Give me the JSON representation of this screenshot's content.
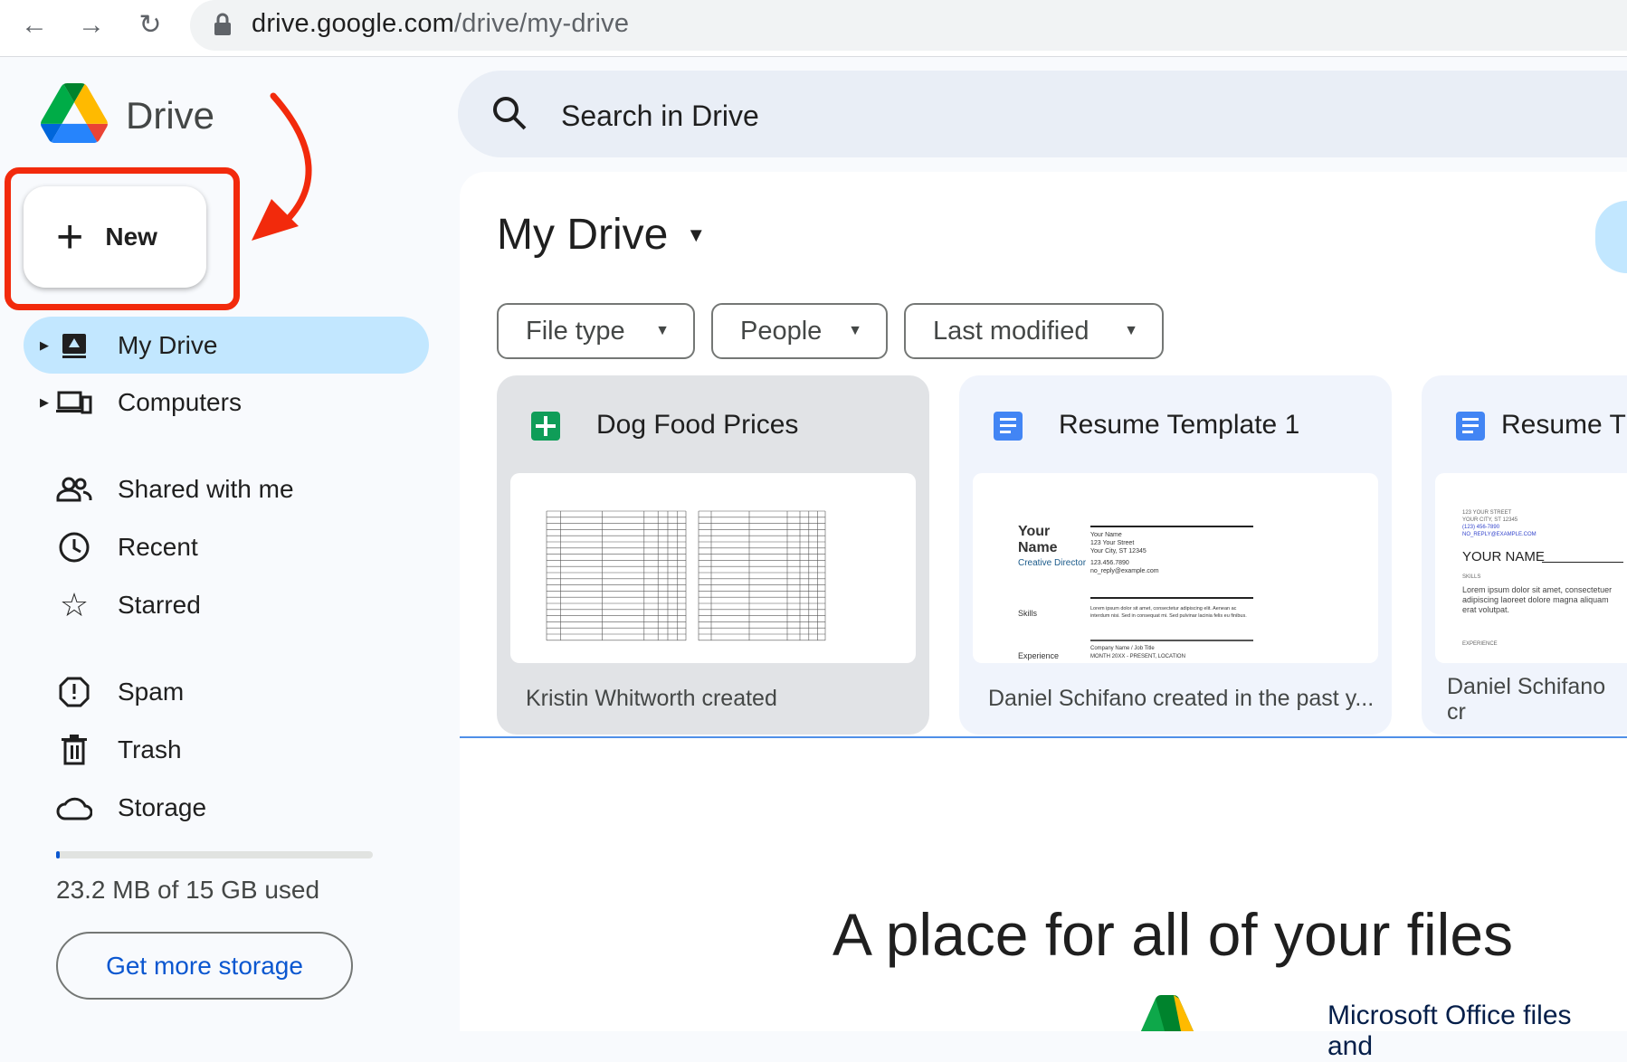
{
  "browser": {
    "url_host": "drive.google.com",
    "url_path": "/drive/my-drive"
  },
  "app": {
    "name": "Drive"
  },
  "sidebar": {
    "new_label": "New",
    "items": [
      {
        "label": "My Drive",
        "icon": "my-drive-icon",
        "active": true
      },
      {
        "label": "Computers",
        "icon": "computers-icon"
      },
      {
        "label": "Shared with me",
        "icon": "people-icon"
      },
      {
        "label": "Recent",
        "icon": "clock-icon"
      },
      {
        "label": "Starred",
        "icon": "star-icon"
      },
      {
        "label": "Spam",
        "icon": "spam-icon"
      },
      {
        "label": "Trash",
        "icon": "trash-icon"
      },
      {
        "label": "Storage",
        "icon": "cloud-icon"
      }
    ],
    "storage_used_fraction": 0.0015,
    "storage_text": "23.2 MB of 15 GB used",
    "get_storage_label": "Get more storage"
  },
  "search": {
    "placeholder": "Search in Drive"
  },
  "main": {
    "title": "My Drive",
    "filters": [
      "File type",
      "People",
      "Last modified"
    ],
    "files": [
      {
        "name": "Dog Food Prices",
        "type": "sheets",
        "meta": "Kristin Whitworth created"
      },
      {
        "name": "Resume Template 1",
        "type": "docs",
        "meta": "Daniel Schifano created in the past y..."
      },
      {
        "name": "Resume T",
        "type": "docs",
        "meta": "Daniel Schifano cr"
      }
    ],
    "preview_resume1": {
      "your": "Your",
      "name": "Name",
      "role": "Creative Director",
      "right_name": "Your Name",
      "street": "123 Your Street",
      "city": "Your City, ST 12345",
      "phone": "123.456.7890",
      "email": "no_reply@example.com",
      "skills": "Skills",
      "experience": "Experience",
      "company": "Company Name / Job Title",
      "period": "MONTH 20XX - PRESENT, LOCATION",
      "lorem": "Lorem ipsum dolor sit amet, consectetur adipiscing elit. Aenean ac interdum nisi. Sed in consequat mi. Sed pulvinar lacinia felis eu finibus."
    },
    "preview_resume2": {
      "street": "123 YOUR STREET",
      "city": "YOUR CITY, ST 12345",
      "phone": "(123) 456-7890",
      "email": "NO_REPLY@EXAMPLE.COM",
      "name": "YOUR NAME",
      "skills": "SKILLS",
      "lorem": "Lorem ipsum dolor sit amet, consectetuer adipiscing laoreet dolore magna aliquam erat volutpat.",
      "experience": "EXPERIENCE"
    },
    "empty_title": "A place for all of your files",
    "empty_sub": "Microsoft Office files and"
  },
  "colors": {
    "accent": "#0b57d0",
    "active_nav": "#c2e7ff",
    "annotation": "#f22a0c"
  }
}
